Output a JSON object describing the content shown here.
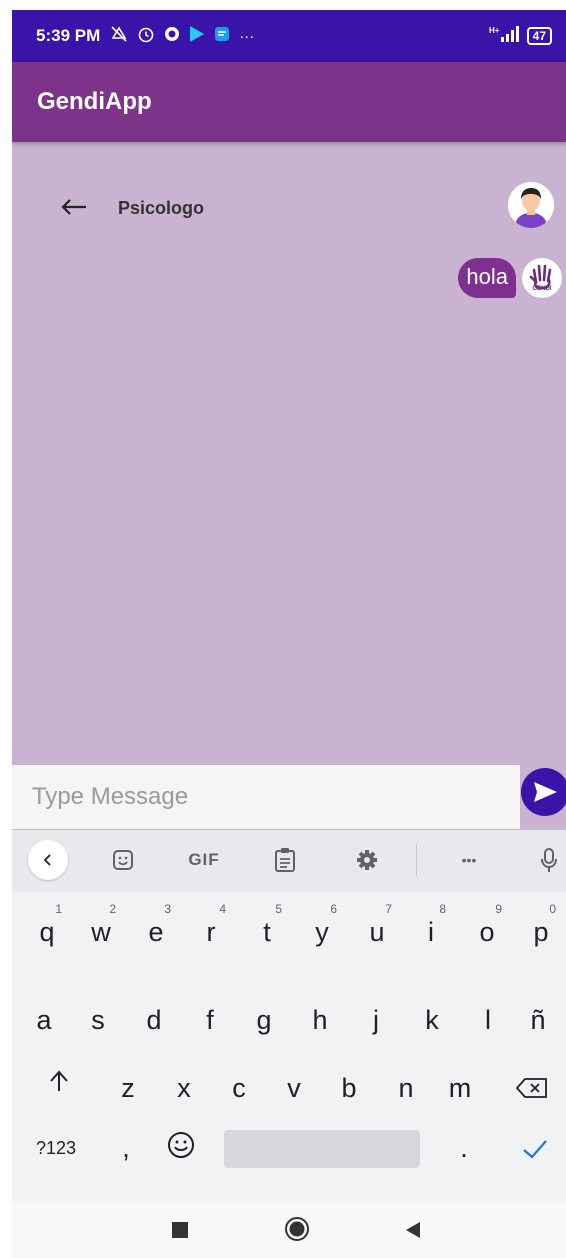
{
  "status_bar": {
    "time": "5:39 PM",
    "notification_overflow": "···",
    "network": "H+",
    "battery": "47"
  },
  "app_bar": {
    "title": "GendiApp"
  },
  "chat": {
    "contact_name": "Psicologo",
    "messages": [
      {
        "text": "hola",
        "sender": "me"
      }
    ],
    "gendi_logo_text": "GENDI"
  },
  "composer": {
    "placeholder": "Type Message",
    "value": ""
  },
  "keyboard": {
    "toolbar": {
      "gif_label": "GIF",
      "more_label": "•••"
    },
    "row1": [
      {
        "k": "q",
        "n": "1"
      },
      {
        "k": "w",
        "n": "2"
      },
      {
        "k": "e",
        "n": "3"
      },
      {
        "k": "r",
        "n": "4"
      },
      {
        "k": "t",
        "n": "5"
      },
      {
        "k": "y",
        "n": "6"
      },
      {
        "k": "u",
        "n": "7"
      },
      {
        "k": "i",
        "n": "8"
      },
      {
        "k": "o",
        "n": "9"
      },
      {
        "k": "p",
        "n": "0"
      }
    ],
    "row2": [
      "a",
      "s",
      "d",
      "f",
      "g",
      "h",
      "j",
      "k",
      "l",
      "ñ"
    ],
    "row3": [
      "z",
      "x",
      "c",
      "v",
      "b",
      "n",
      "m"
    ],
    "symbols_key": "?123",
    "comma_key": ",",
    "period_key": "."
  },
  "colors": {
    "status_bar": "#3a14a8",
    "app_bar": "#7d3389",
    "chat_background": "#c9b3d0",
    "bubble": "#7e2f90",
    "send_button": "#3a14a8",
    "done_check": "#1a73e8"
  }
}
